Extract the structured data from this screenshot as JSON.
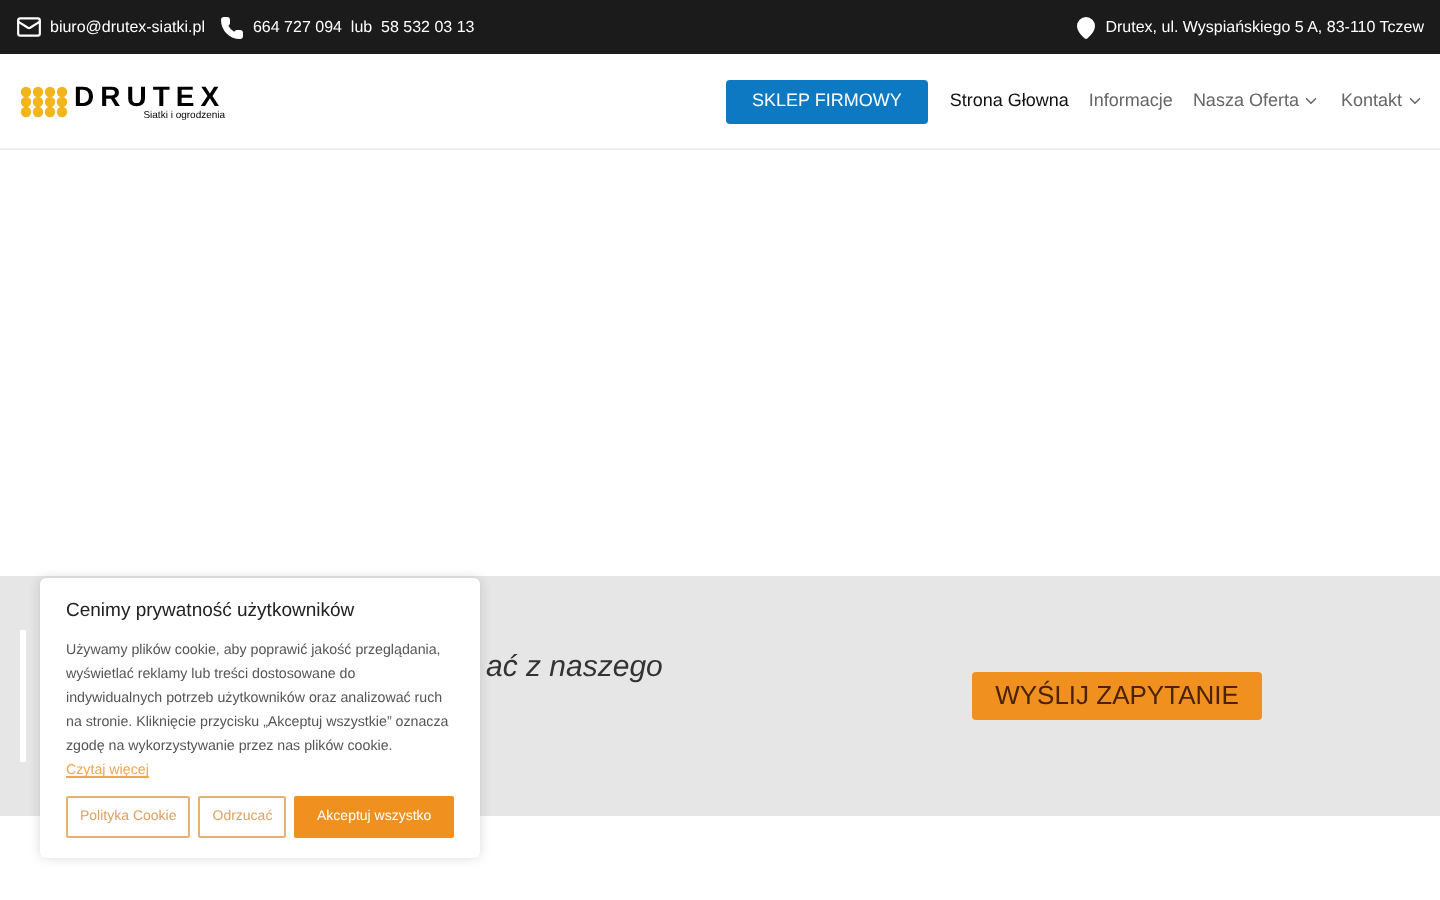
{
  "topbar": {
    "email": "biuro@drutex-siatki.pl",
    "phone": "664 727 094  lub  58 532 03 13",
    "address": "Drutex, ul. Wyspiańskiego 5 A, 83-110 Tczew"
  },
  "logo": {
    "name": "DRUTEX",
    "tagline": "Siatki i ogrodzenia"
  },
  "nav": [
    {
      "label": "SKLEP FIRMOWY",
      "kind": "cta"
    },
    {
      "label": "Strona Głowna",
      "kind": "current"
    },
    {
      "label": "Informacje",
      "kind": "link"
    },
    {
      "label": "Nasza Oferta",
      "kind": "menu"
    },
    {
      "label": "Kontakt",
      "kind": "menu"
    }
  ],
  "banner": {
    "text": "ać z naszego",
    "button": "WYŚLIJ ZAPYTANIE"
  },
  "cookie": {
    "title": "Cenimy prywatność użytkowników",
    "text": "Używamy plików cookie, aby poprawić jakość przeglądania, wyświetlać reklamy lub treści dostosowane do indywidualnych potrzeb użytkowników oraz analizować ruch na stronie. Kliknięcie przycisku „Akceptuj wszystkie” oznacza zgodę na wykorzystywanie przez nas plików cookie.",
    "link": "Czytaj więcej",
    "buttons": [
      {
        "label": "Polityka Cookie",
        "kind": "outline"
      },
      {
        "label": "Odrzucać",
        "kind": "outline"
      },
      {
        "label": "Akceptuj wszystko",
        "kind": "filled"
      }
    ]
  }
}
